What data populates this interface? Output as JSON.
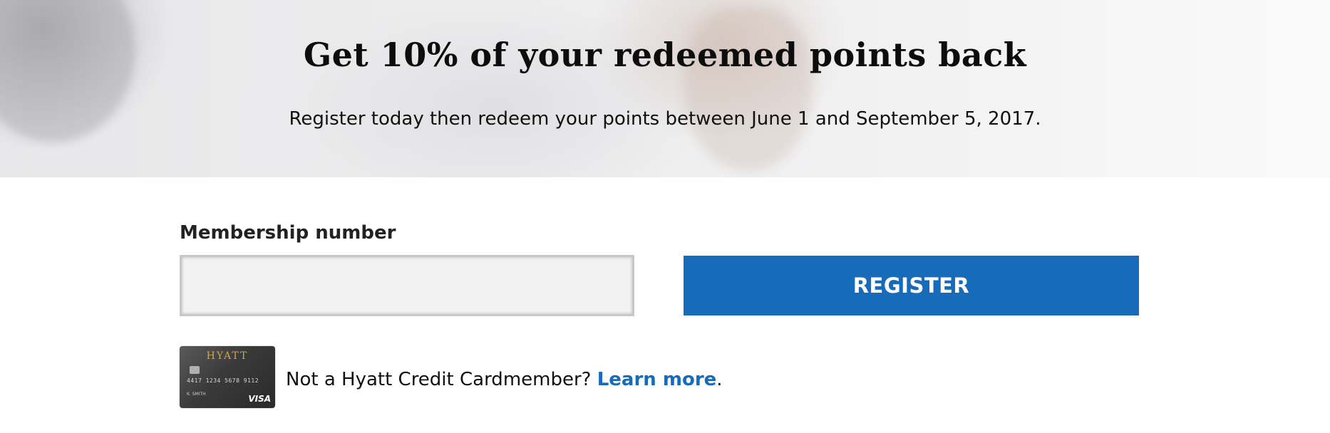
{
  "hero": {
    "title": "Get 10% of your redeemed points back",
    "subtitle": "Register today then redeem your points between June 1 and September 5, 2017."
  },
  "form": {
    "membership_label": "Membership number",
    "membership_value": "",
    "register_label": "REGISTER"
  },
  "card": {
    "logo_text": "HYATT",
    "number_text": "4417 1234 5678 9112",
    "holder_text": "K. SMITH",
    "network": "VISA",
    "icon": "credit-card-icon"
  },
  "cardmember": {
    "prompt": "Not a Hyatt Credit Cardmember?",
    "link_label": "Learn more",
    "suffix": "."
  },
  "colors": {
    "accent": "#176bb8",
    "input_bg": "#f2f2f2"
  }
}
